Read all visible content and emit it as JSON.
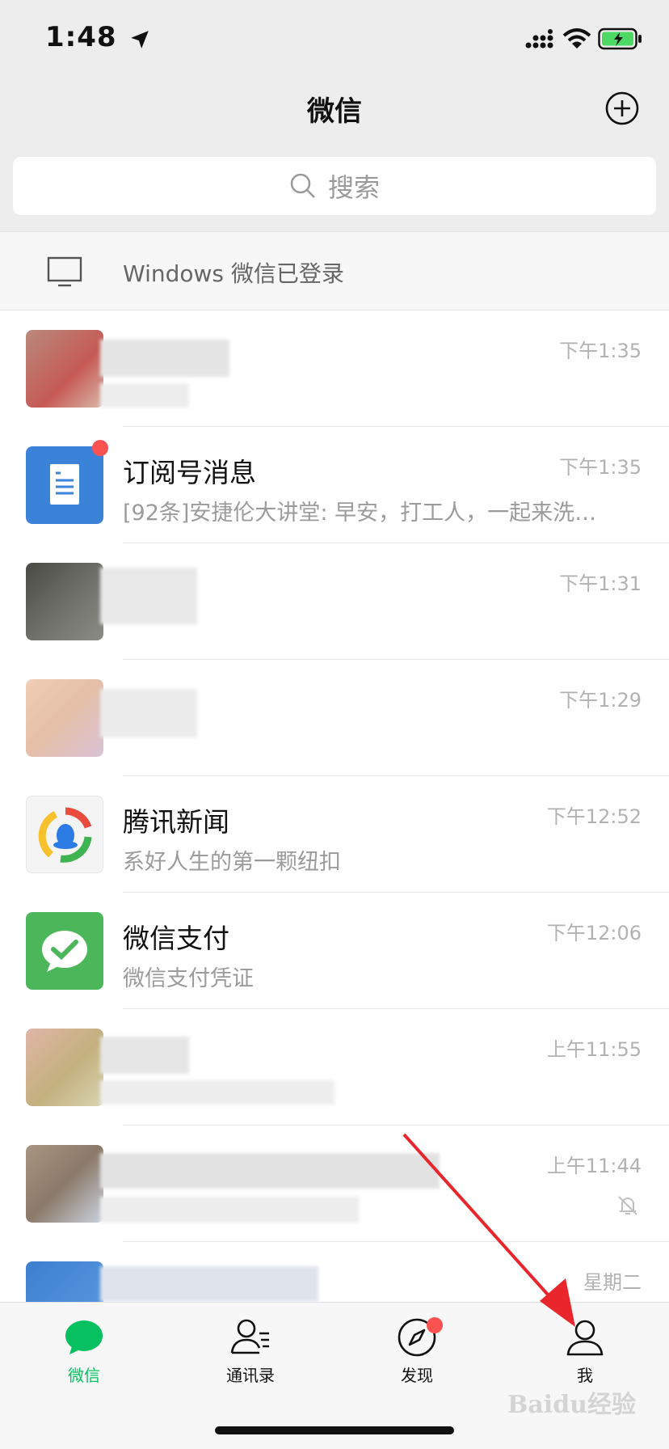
{
  "status_bar": {
    "time": "1:48"
  },
  "nav": {
    "title": "微信"
  },
  "search": {
    "placeholder": "搜索"
  },
  "login_banner": {
    "text": "Windows 微信已登录"
  },
  "chats": [
    {
      "name": "",
      "preview": "",
      "time": "下午1:35"
    },
    {
      "name": "订阅号消息",
      "preview": "[92条]安捷伦大讲堂: 早安，打工人，一起来洗…",
      "time": "下午1:35"
    },
    {
      "name": "",
      "preview": "",
      "time": "下午1:31"
    },
    {
      "name": "",
      "preview": "",
      "time": "下午1:29"
    },
    {
      "name": "腾讯新闻",
      "preview": "系好人生的第一颗纽扣",
      "time": "下午12:52"
    },
    {
      "name": "微信支付",
      "preview": "微信支付凭证",
      "time": "下午12:06"
    },
    {
      "name": "",
      "preview": "",
      "time": "上午11:55"
    },
    {
      "name": "",
      "preview": "",
      "time": "上午11:44"
    },
    {
      "name": "",
      "preview": "",
      "time": "星期二"
    }
  ],
  "tabs": [
    {
      "label": "微信"
    },
    {
      "label": "通讯录"
    },
    {
      "label": "发现"
    },
    {
      "label": "我"
    }
  ],
  "watermark": "Baidu经验",
  "colors": {
    "accent": "#07c160",
    "badge": "#fa5151",
    "background": "#ededed"
  }
}
